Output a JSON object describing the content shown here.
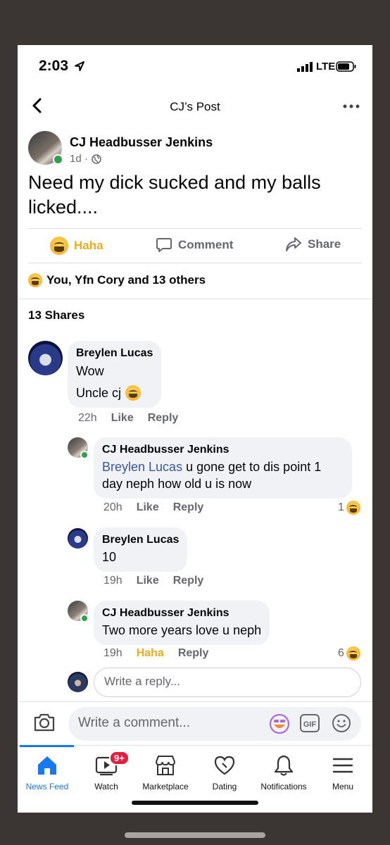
{
  "status_bar": {
    "time": "2:03",
    "carrier": "LTE"
  },
  "header": {
    "title": "CJ’s Post"
  },
  "post": {
    "author": "CJ Headbusser Jenkins",
    "time": "1d ·",
    "text": "Need my dick sucked and my balls licked....",
    "actions": {
      "haha": "Haha",
      "comment": "Comment",
      "share": "Share"
    },
    "reactions_summary": "You, Yfn Cory and 13 others",
    "shares": "13 Shares"
  },
  "comments": [
    {
      "name": "Breylen Lucas",
      "line1": "Wow",
      "line2": "Uncle cj",
      "time": "22h",
      "like": "Like",
      "reply": "Reply"
    },
    {
      "name": "CJ Headbusser Jenkins",
      "mention": "Breylen Lucas",
      "text": " u gone get to dis point 1 day neph how old u is now",
      "time": "20h",
      "like": "Like",
      "reply": "Reply",
      "reaction_count": "1"
    },
    {
      "name": "Breylen Lucas",
      "text": "10",
      "time": "19h",
      "like": "Like",
      "reply": "Reply"
    },
    {
      "name": "CJ Headbusser Jenkins",
      "text": "Two more years love u neph",
      "time": "19h",
      "like": "Haha",
      "reply": "Reply",
      "reaction_count": "6"
    }
  ],
  "reply_input": {
    "placeholder": "Write a reply..."
  },
  "comment_input": {
    "placeholder": "Write a comment...",
    "gif_label": "GIF"
  },
  "tabs": [
    {
      "label": "News Feed",
      "icon": "home-icon"
    },
    {
      "label": "Watch",
      "icon": "watch-icon",
      "badge": "9+"
    },
    {
      "label": "Marketplace",
      "icon": "marketplace-icon"
    },
    {
      "label": "Dating",
      "icon": "dating-icon"
    },
    {
      "label": "Notifications",
      "icon": "bell-icon"
    },
    {
      "label": "Menu",
      "icon": "menu-icon"
    }
  ],
  "colors": {
    "accent": "#1877f2",
    "haha": "#e9ad20",
    "mention": "#385898",
    "online": "#31a24c",
    "badge": "#e41e3f"
  }
}
